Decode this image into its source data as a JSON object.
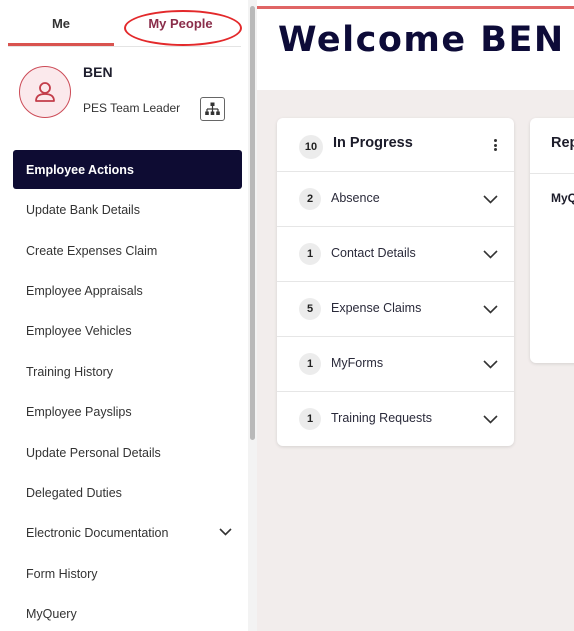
{
  "sidebar": {
    "tabs": {
      "me": "Me",
      "my_people": "My People"
    },
    "user": {
      "name": "BEN",
      "role": "PES Team Leader"
    },
    "items": [
      {
        "label": "Employee Actions"
      },
      {
        "label": "Update Bank Details"
      },
      {
        "label": "Create Expenses Claim"
      },
      {
        "label": "Employee Appraisals"
      },
      {
        "label": "Employee Vehicles"
      },
      {
        "label": "Training History"
      },
      {
        "label": "Employee Payslips"
      },
      {
        "label": "Update Personal Details"
      },
      {
        "label": "Delegated Duties"
      },
      {
        "label": "Electronic Documentation"
      },
      {
        "label": "Form History"
      },
      {
        "label": "MyQuery"
      }
    ]
  },
  "header": {
    "title": "Welcome BEN"
  },
  "in_progress": {
    "count": "10",
    "title": "In Progress",
    "rows": [
      {
        "count": "2",
        "label": "Absence"
      },
      {
        "count": "1",
        "label": "Contact Details"
      },
      {
        "count": "5",
        "label": "Expense Claims"
      },
      {
        "count": "1",
        "label": "MyForms"
      },
      {
        "count": "1",
        "label": "Training Requests"
      }
    ]
  },
  "right_card": {
    "title": "Rep",
    "sub": "MyQ"
  },
  "colors": {
    "nav_active_bg": "#0e0c33",
    "accent_red": "#d9534f",
    "my_people_tab": "#8a2d4a",
    "annotation_circle": "#e3292b"
  },
  "icons": {
    "avatar": "user-icon",
    "org": "org-chart-icon",
    "chevron": "chevron-down-icon",
    "kebab": "more-vertical-icon"
  }
}
